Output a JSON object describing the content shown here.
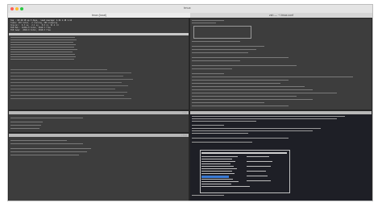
{
  "window": {
    "title": "tmux",
    "left_meta": "Finder",
    "right_meta": "tmux"
  },
  "tabs": [
    {
      "label": "tmux (local)"
    },
    {
      "label": "zsh — ~/.tmux.conf"
    }
  ],
  "panes": {
    "top_left": {
      "header": "top - 10:42:18 up 3 days"
    },
    "bottom_left_1": {
      "header": "htop"
    },
    "bottom_left_2": {
      "header": "iftop"
    },
    "top_right": {
      "header": "~/.tmux.conf"
    },
    "bottom_right": {
      "header": "tmux list-keys"
    }
  },
  "colors": {
    "accent": "#3a7bd5",
    "pane_bg": "#3d3d3d",
    "dark_bg": "#1e1f26"
  }
}
